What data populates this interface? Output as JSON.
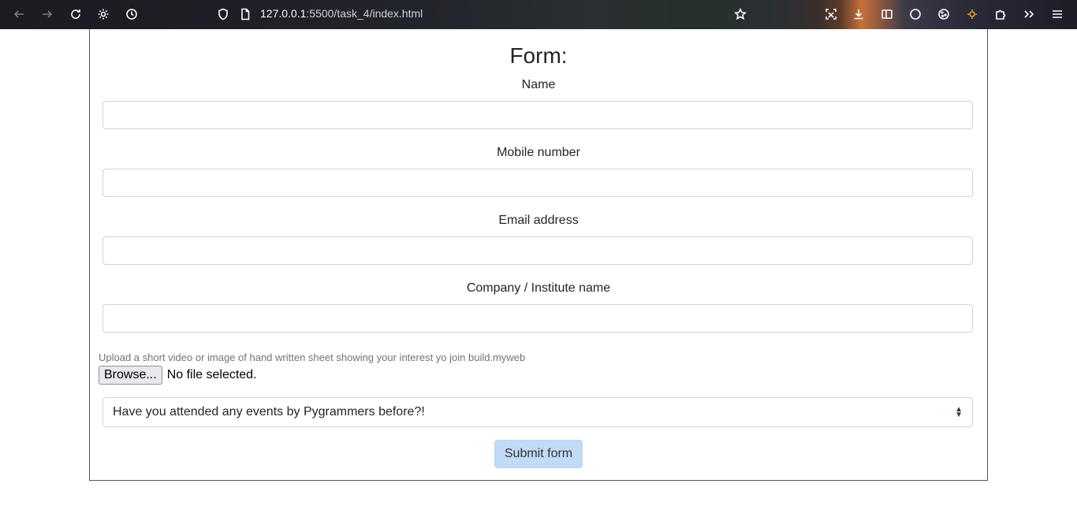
{
  "browser": {
    "url_host": "127.0.0.1",
    "url_rest": ":5500/task_4/index.html",
    "icons": [
      "back-icon",
      "forward-icon",
      "reload-icon",
      "gear-icon",
      "history-icon",
      "shield-icon",
      "page-icon",
      "star-icon",
      "screenshot-icon",
      "download-icon",
      "sidebar-icon",
      "circle-icon",
      "cookie-icon",
      "extension-icon",
      "puzzle-icon",
      "overflow-icon",
      "menu-icon"
    ]
  },
  "form": {
    "title": "Form:",
    "fields": [
      {
        "label": "Name",
        "value": ""
      },
      {
        "label": "Mobile number",
        "value": ""
      },
      {
        "label": "Email address",
        "value": ""
      },
      {
        "label": "Company / Institute name",
        "value": ""
      }
    ],
    "upload_hint": "Upload a short video or image of hand written sheet showing your interest yo join build.myweb",
    "browse_label": "Browse...",
    "file_status": "No file selected.",
    "select_value": "Have you attended any events by Pygrammers before?!",
    "submit_label": "Submit form"
  },
  "colors": {
    "submit_bg": "#c1daf6",
    "border": "#ced4da"
  }
}
